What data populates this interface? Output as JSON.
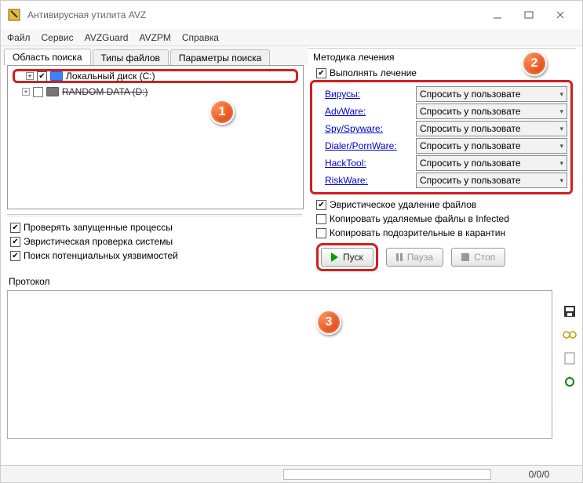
{
  "window": {
    "title": "Антивирусная утилита AVZ",
    "menu": [
      "Файл",
      "Сервис",
      "AVZGuard",
      "AVZPM",
      "Справка"
    ],
    "tabs": [
      "Область поиска",
      "Типы файлов",
      "Параметры поиска"
    ]
  },
  "tree": {
    "item1_label": "Локальный диск (C:)",
    "item2_label": "RANDOM DATA (D:)"
  },
  "left_checks": {
    "c1": "Проверять запущенные процессы",
    "c2": "Эвристическая проверка системы",
    "c3": "Поиск потенциальных уязвимостей"
  },
  "protocol_label": "Протокол",
  "treatment": {
    "heading": "Методика лечения",
    "perform": "Выполнять лечение",
    "links": [
      "Вирусы:",
      "AdvWare:",
      "Spy/Spyware:",
      "Dialer/PornWare:",
      "HackTool:",
      "RiskWare:"
    ],
    "option_text": "Спросить у пользовате",
    "h1": "Эвристическое удаление файлов",
    "h2": "Копировать удаляемые файлы в  Infected",
    "h3": "Копировать подозрительные в  карантин"
  },
  "buttons": {
    "start": "Пуск",
    "pause": "Пауза",
    "stop": "Стоп"
  },
  "status": {
    "counts": "0/0/0"
  },
  "markers": {
    "m1": "1",
    "m2": "2",
    "m3": "3"
  }
}
